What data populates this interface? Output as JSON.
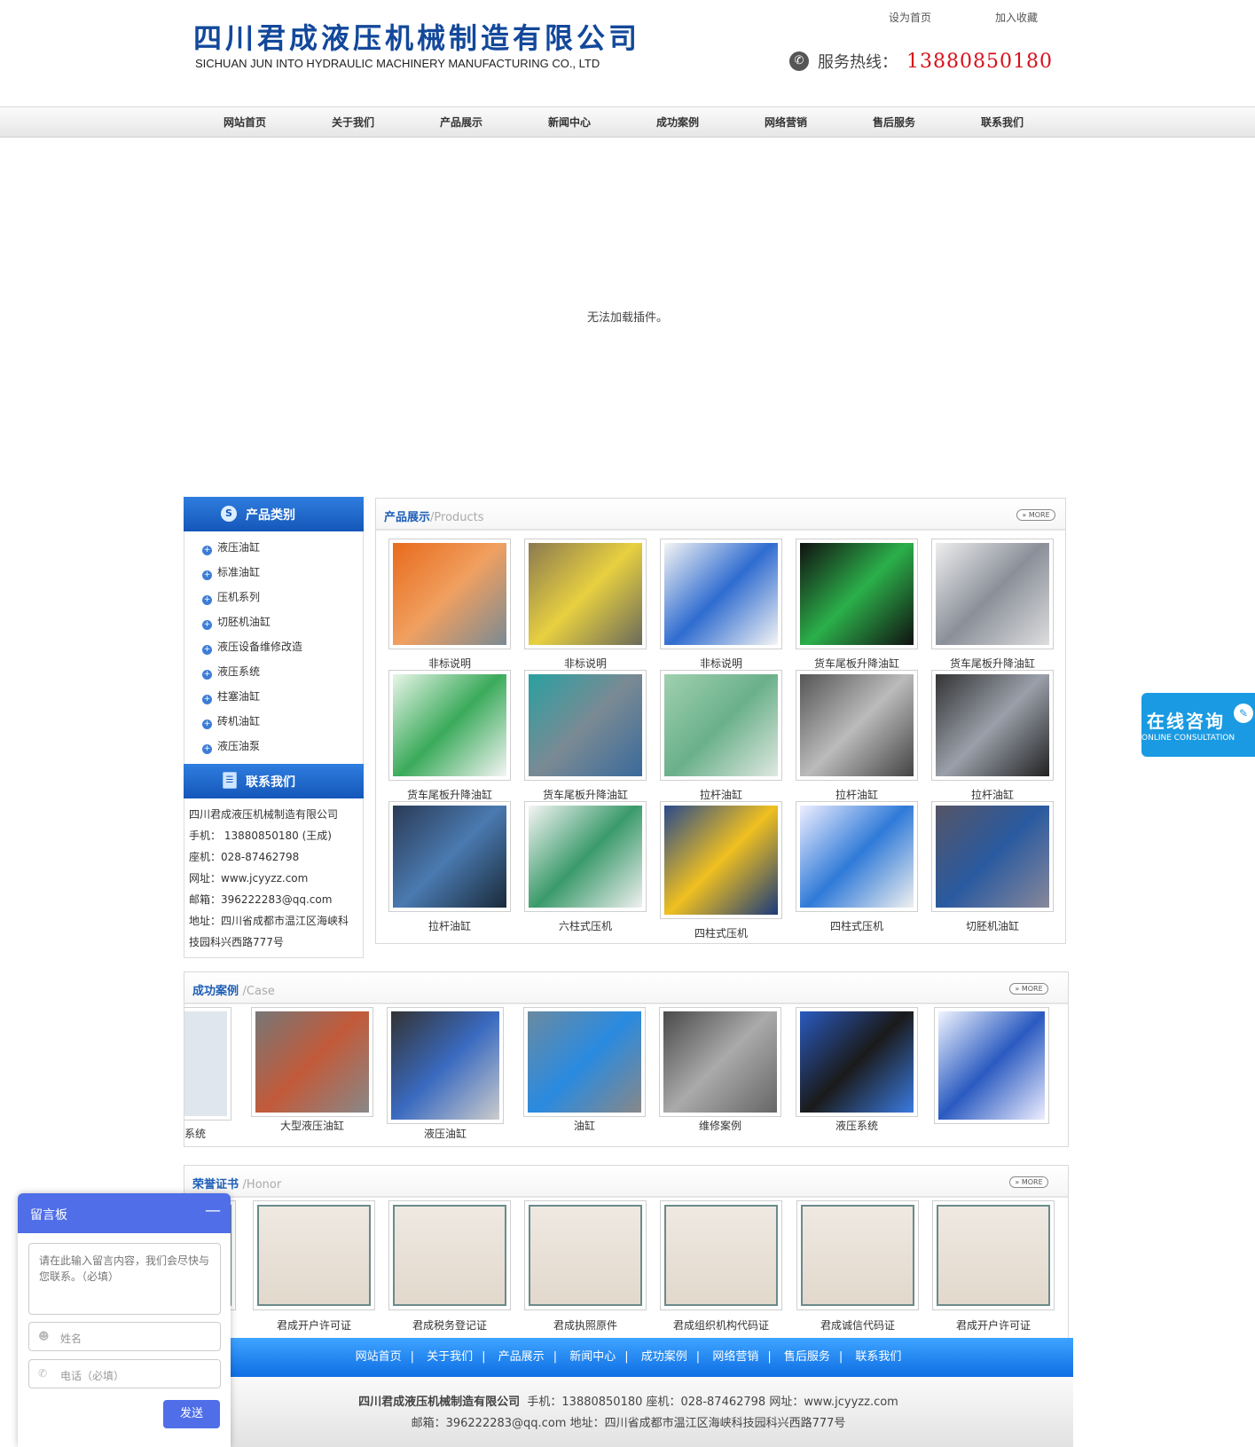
{
  "header": {
    "logo_cn": "四川君成液压机械制造有限公司",
    "logo_en": "SICHUAN JUN INTO HYDRAULIC MACHINERY MANUFACTURING CO., LTD",
    "set_home": "设为首页",
    "add_fav": "加入收藏",
    "hotline_label": "服务热线：",
    "hotline_number": "13880850180"
  },
  "nav": [
    "网站首页",
    "关于我们",
    "产品展示",
    "新闻中心",
    "成功案例",
    "网络营销",
    "售后服务",
    "联系我们"
  ],
  "banner": {
    "message": "无法加载插件。"
  },
  "left": {
    "category_title": "产品类别",
    "categories": [
      "液压油缸",
      "标准油缸",
      "压机系列",
      "切胚机油缸",
      "液压设备维修改造",
      "液压系统",
      "柱塞油缸",
      "砖机油缸",
      "液压油泵"
    ],
    "contact_title": "联系我们",
    "contact_lines": [
      "四川君成液压机械制造有限公司",
      "手机：  13880850180 (王成)",
      "座机：028-87462798",
      "网址：www.jcyyzz.com",
      "邮箱：396222283@qq.com",
      "地址：四川省成都市温江区海峡科",
      "技园科兴西路777号"
    ]
  },
  "products": {
    "title": "产品展示",
    "subtitle": "/Products",
    "more": "» MORE",
    "items": [
      "非标说明",
      "非标说明",
      "非标说明",
      "货车尾板升降油缸",
      "货车尾板升降油缸",
      "货车尾板升降油缸",
      "货车尾板升降油缸",
      "拉杆油缸",
      "拉杆油缸",
      "拉杆油缸",
      "拉杆油缸",
      "六柱式压机",
      "四柱式压机",
      "四柱式压机",
      "切胚机油缸"
    ]
  },
  "cases": {
    "title": "成功案例",
    "subtitle": "/Case",
    "more": "» MORE",
    "items": [
      "系统",
      "大型液压油缸",
      "液压油缸",
      "油缸",
      "维修案例",
      "液压系统",
      ""
    ]
  },
  "honor": {
    "title": "荣誉证书",
    "subtitle": "/Honor",
    "more": "» MORE",
    "items": [
      "",
      "君成开户许可证",
      "君成税务登记证",
      "君成执照原件",
      "君成组织机构代码证",
      "君成诚信代码证",
      "君成开户许可证"
    ]
  },
  "footer": {
    "nav": [
      "网站首页",
      "关于我们",
      "产品展示",
      "新闻中心",
      "成功案例",
      "网络营销",
      "售后服务",
      "联系我们"
    ],
    "company": "四川君成液压机械制造有限公司",
    "line1_rest": "手机：13880850180  座机：028-87462798  网址：www.jcyyzz.com",
    "line2": "邮箱：396222283@qq.com  地址：四川省成都市温江区海峡科技园科兴西路777号"
  },
  "online": {
    "title": "在线咨询",
    "subtitle": "ONLINE CONSULTATION"
  },
  "guestbook": {
    "title": "留言板",
    "message_placeholder": "请在此输入留言内容，我们会尽快与您联系。（必填）",
    "name_placeholder": "姓名",
    "phone_placeholder": "电话（必填）",
    "send": "发送"
  },
  "colors": {
    "brand_blue": "#13489b",
    "hotline_red": "#d6111a",
    "accent_blue": "#1e5fb8",
    "guestbook_blue": "#4f6ee8"
  }
}
